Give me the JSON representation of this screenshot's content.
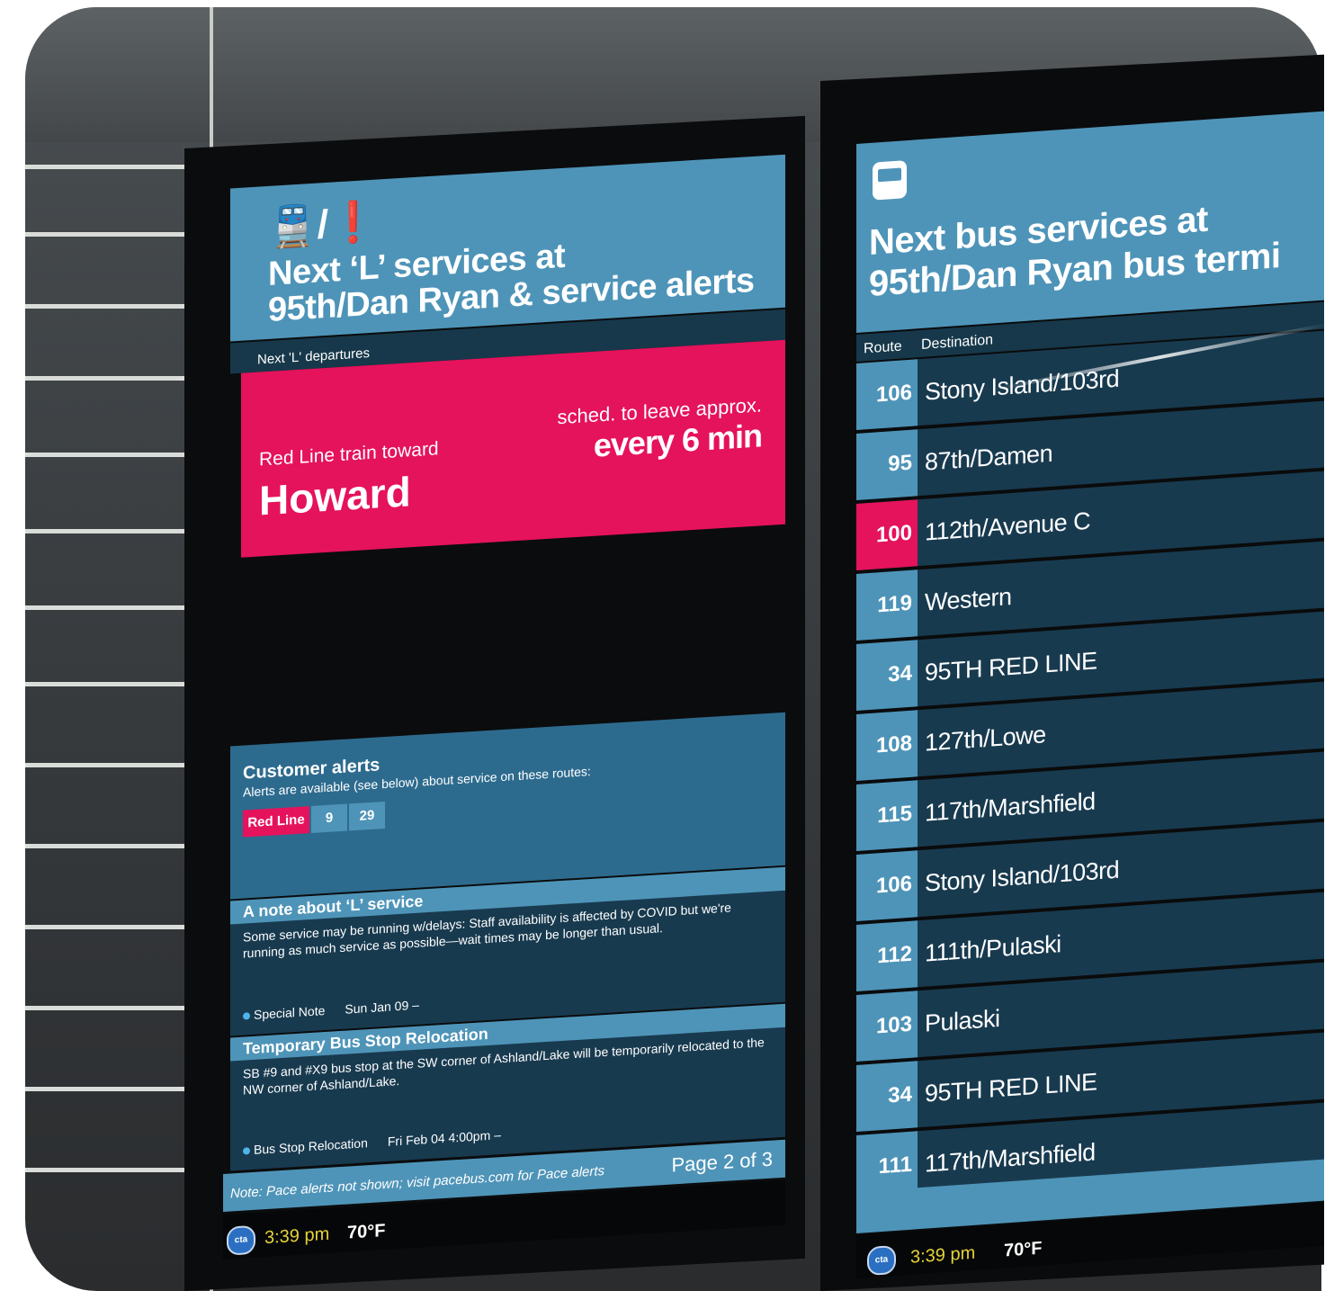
{
  "left_screen": {
    "header": {
      "icons": "🚆/❗",
      "title_line1": "Next ‘L’ services at",
      "title_line2": "95th/Dan Ryan & service alerts"
    },
    "departures_label": "Next 'L' departures",
    "departure": {
      "line": "Red Line train toward",
      "destination": "Howard",
      "schedule": "sched. to leave approx.",
      "frequency": "every 6 min"
    },
    "customer_alerts": {
      "title": "Customer alerts",
      "text": "Alerts are available (see below) about service on these routes:",
      "routes": [
        "Red Line",
        "9",
        "29"
      ]
    },
    "note": {
      "title": "A note about ‘L’ service",
      "body": "Some service may be running w/delays: Staff availability is affected by COVID but we're running as much service as possible—wait times may be longer than usual.",
      "tag": "Special Note",
      "date": "Sun Jan 09 –"
    },
    "alert2": {
      "title": "Temporary Bus Stop Relocation",
      "body": "SB #9 and #X9 bus stop at the SW corner of Ashland/Lake will be temporarily relocated to the NW corner of Ashland/Lake.",
      "tag": "Bus Stop Relocation",
      "date": "Fri Feb 04 4:00pm –"
    },
    "footer": {
      "note": "Note: Pace alerts not shown; visit pacebus.com for Pace alerts",
      "page": "Page 2 of 3"
    },
    "status": {
      "logo": "cta",
      "time": "3:39 pm",
      "temp": "70°F"
    }
  },
  "right_screen": {
    "header": {
      "icon": "bus-icon",
      "title_line1": "Next bus services at",
      "title_line2": "95th/Dan Ryan bus termi"
    },
    "columns": {
      "route": "Route",
      "destination": "Destination"
    },
    "rows": [
      {
        "route": "106",
        "destination": "Stony Island/103rd",
        "highlight": false
      },
      {
        "route": "95",
        "destination": "87th/Damen",
        "highlight": false
      },
      {
        "route": "100",
        "destination": "112th/Avenue C",
        "highlight": true
      },
      {
        "route": "119",
        "destination": "Western",
        "highlight": false
      },
      {
        "route": "34",
        "destination": "95TH RED LINE",
        "highlight": false
      },
      {
        "route": "108",
        "destination": "127th/Lowe",
        "highlight": false
      },
      {
        "route": "115",
        "destination": "117th/Marshfield",
        "highlight": false
      },
      {
        "route": "106",
        "destination": "Stony Island/103rd",
        "highlight": false
      },
      {
        "route": "112",
        "destination": "111th/Pulaski",
        "highlight": false
      },
      {
        "route": "103",
        "destination": "Pulaski",
        "highlight": false
      },
      {
        "route": "34",
        "destination": "95TH RED LINE",
        "highlight": false
      },
      {
        "route": "111",
        "destination": "117th/Marshfield",
        "highlight": false
      }
    ],
    "status": {
      "logo": "cta",
      "time": "3:39 pm",
      "temp": "70°F"
    }
  },
  "colors": {
    "accent_blue": "#4e94b8",
    "dark_blue": "#183a4f",
    "red_line": "#e5125c",
    "time_yellow": "#e4d23a"
  }
}
